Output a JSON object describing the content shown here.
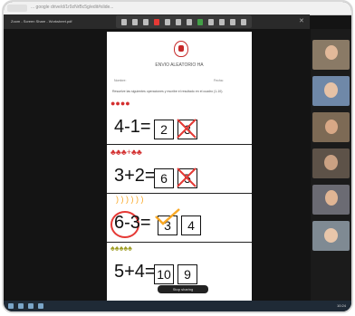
{
  "browser": {
    "url": "... google drive/d/1r9zNrBc5g/edit#slide..."
  },
  "window": {
    "title": "Zoom - Screen Share - Worksheet.pdf"
  },
  "document": {
    "title": "ENVIO ALEATORIO HA",
    "name_label": "Nombre:",
    "date_label": "Fecha:",
    "instruction": "Resuelve las siguientes operaciones y escribe el resultado en el cuadro (1-10).",
    "problems": [
      {
        "expression": "4-1=",
        "answer": "2",
        "crossed": "3"
      },
      {
        "expression": "3+2=",
        "answer": "6",
        "crossed": "5"
      },
      {
        "expression": "6-3=",
        "answer": "3",
        "crossed": "4"
      },
      {
        "expression": "5+4=",
        "answer": "10",
        "crossed": "9"
      }
    ]
  },
  "share_control": {
    "label": "Stop sharing"
  },
  "taskbar": {
    "time": "10:24"
  }
}
